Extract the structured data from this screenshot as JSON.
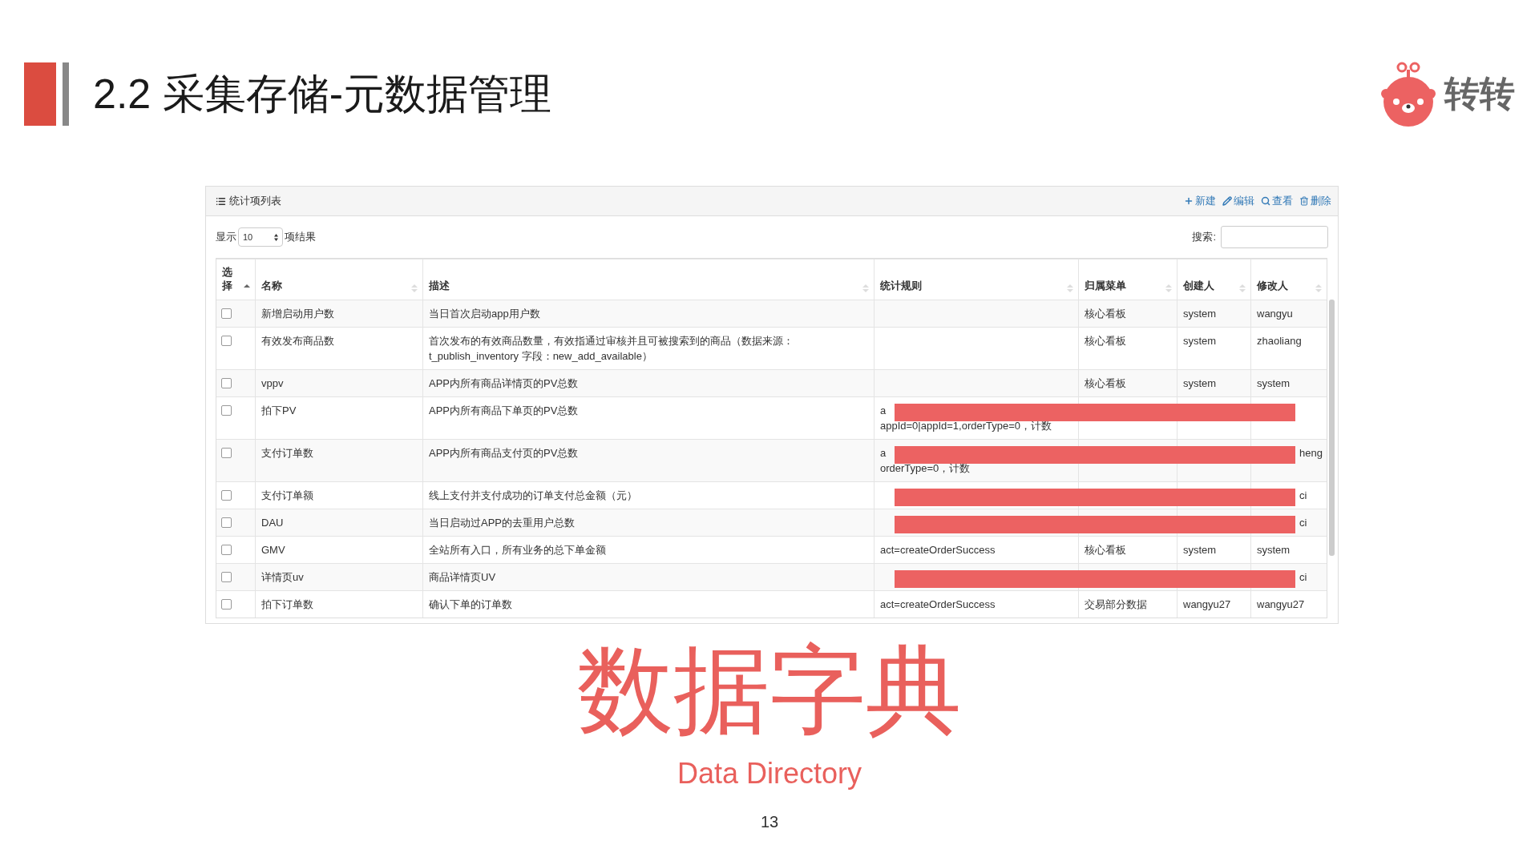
{
  "slide": {
    "section_title": "2.2 采集存储-元数据管理",
    "logo_text": "转转",
    "headline": "数据字典",
    "subtitle": "Data Directory",
    "page_number": "13"
  },
  "panel": {
    "title": "统计项列表",
    "actions": [
      {
        "kind": "new",
        "label": "新建"
      },
      {
        "kind": "edit",
        "label": "编辑"
      },
      {
        "kind": "view",
        "label": "查看"
      },
      {
        "kind": "delete",
        "label": "删除"
      }
    ],
    "length_prefix": "显示",
    "length_value": "10",
    "length_suffix": "项结果",
    "search_label": "搜索:"
  },
  "table": {
    "columns": [
      {
        "label": "选择",
        "sorted": true
      },
      {
        "label": "名称",
        "sorted": false
      },
      {
        "label": "描述",
        "sorted": false
      },
      {
        "label": "统计规则",
        "sorted": false
      },
      {
        "label": "归属菜单",
        "sorted": false
      },
      {
        "label": "创建人",
        "sorted": false
      },
      {
        "label": "修改人",
        "sorted": false
      }
    ],
    "rows": [
      {
        "checked": false,
        "redacted": false,
        "cells": [
          "",
          "新增启动用户数",
          "当日首次启动app用户数",
          "",
          "核心看板",
          "system",
          "wangyu"
        ]
      },
      {
        "checked": false,
        "redacted": false,
        "cells": [
          "",
          "有效发布商品数",
          "首次发布的有效商品数量，有效指通过审核并且可被搜索到的商品（数据来源：t_publish_inventory 字段：new_add_available）",
          "",
          "核心看板",
          "system",
          "zhaoliang"
        ]
      },
      {
        "checked": false,
        "redacted": false,
        "cells": [
          "",
          "vppv",
          "APP内所有商品详情页的PV总数",
          "",
          "核心看板",
          "system",
          "system"
        ]
      },
      {
        "checked": false,
        "redacted": true,
        "cells": [
          "",
          "拍下PV",
          "APP内所有商品下单页的PV总数",
          "a\nappId=0|appId=1,orderType=0，计数",
          "",
          "",
          ""
        ]
      },
      {
        "checked": false,
        "redacted": true,
        "cells": [
          "",
          "支付订单数",
          "APP内所有商品支付页的PV总数",
          "a\norderType=0，计数",
          "",
          "",
          "heng"
        ]
      },
      {
        "checked": false,
        "redacted": true,
        "cells": [
          "",
          "支付订单额",
          "线上支付并支付成功的订单支付总金额（元）",
          "",
          "",
          "",
          "ci"
        ]
      },
      {
        "checked": false,
        "redacted": true,
        "cells": [
          "",
          "DAU",
          "当日启动过APP的去重用户总数",
          "",
          "",
          "",
          "ci"
        ]
      },
      {
        "checked": false,
        "redacted": false,
        "cells": [
          "",
          "GMV",
          "全站所有入口，所有业务的总下单金额",
          "act=createOrderSuccess",
          "核心看板",
          "system",
          "system"
        ]
      },
      {
        "checked": false,
        "redacted": true,
        "cells": [
          "",
          "详情页uv",
          "商品详情页UV",
          "",
          "",
          "",
          "ci"
        ]
      },
      {
        "checked": false,
        "redacted": false,
        "cells": [
          "",
          "拍下订单数",
          "确认下单的订单数",
          "act=createOrderSuccess",
          "交易部分数据",
          "wangyu27",
          "wangyu27"
        ]
      }
    ]
  }
}
